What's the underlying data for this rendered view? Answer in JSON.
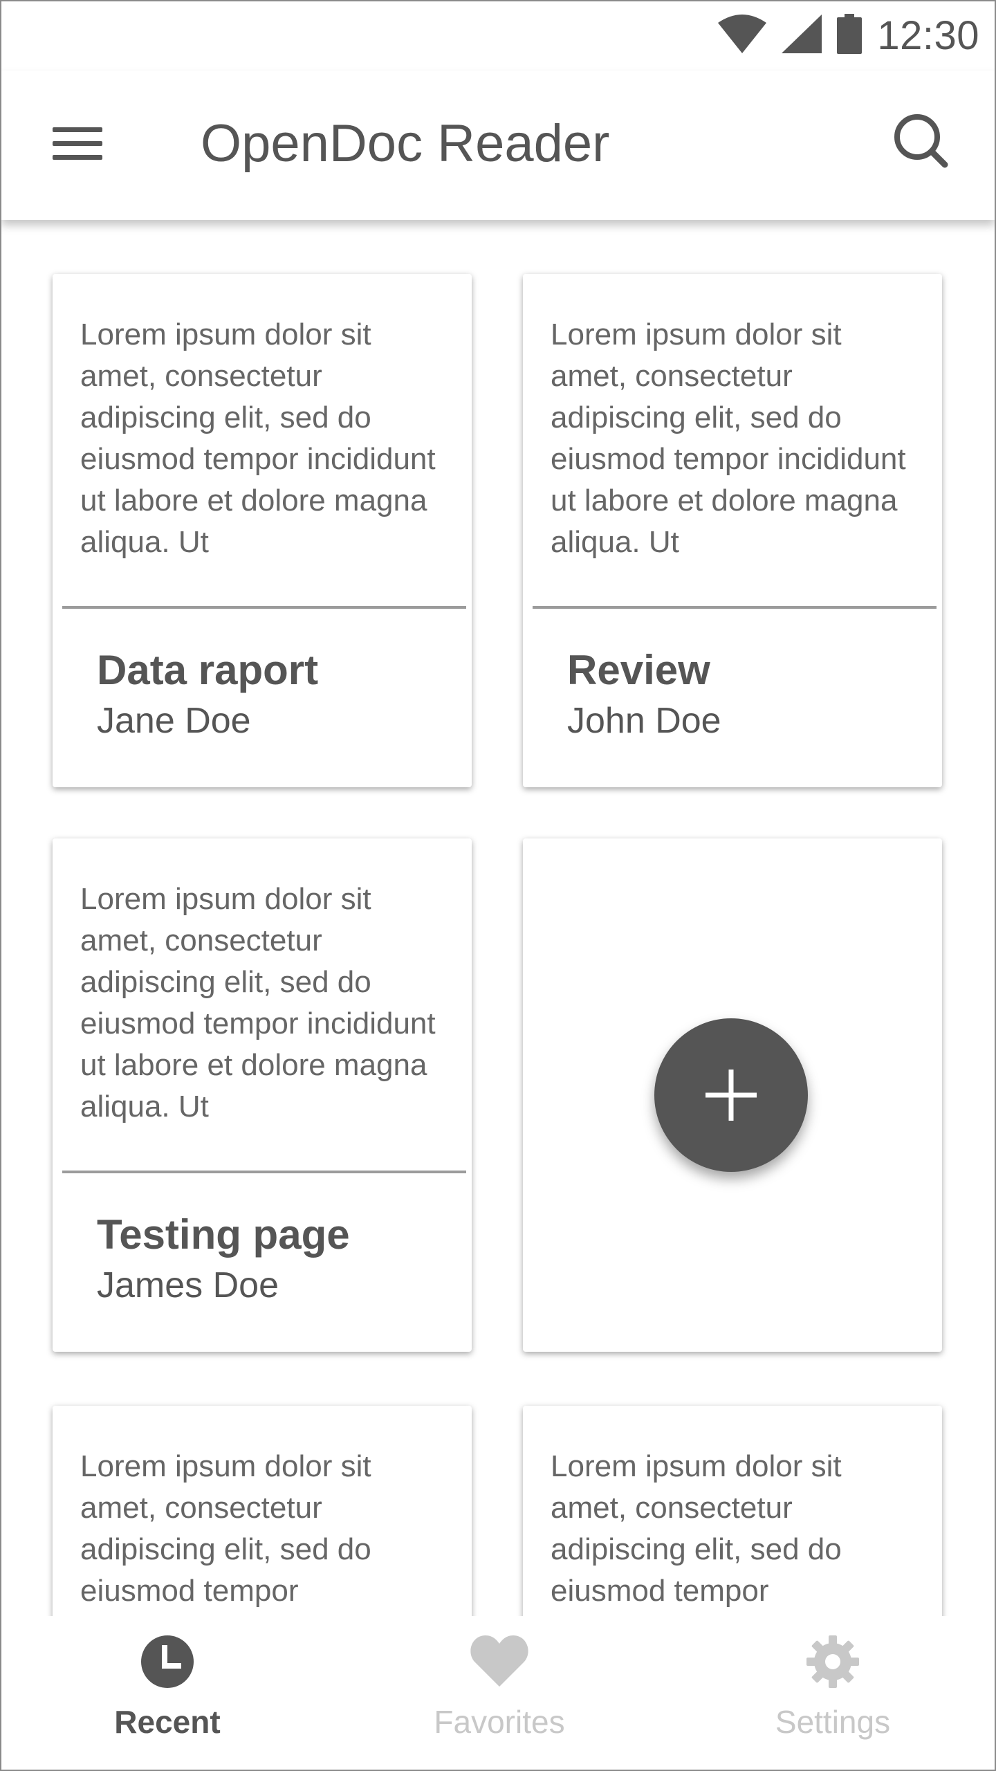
{
  "status_bar": {
    "time": "12:30",
    "icons": [
      "wifi-icon",
      "signal-icon",
      "battery-icon"
    ]
  },
  "app_bar": {
    "menu_icon": "menu-icon",
    "title": "OpenDoc Reader",
    "search_icon": "search-icon"
  },
  "cards": [
    {
      "excerpt": "Lorem ipsum dolor sit amet, consectetur adipiscing elit, sed do eiusmod tempor incididunt ut labore et dolore magna aliqua. Ut",
      "title": "Data raport",
      "author": "Jane Doe"
    },
    {
      "excerpt": "Lorem ipsum dolor sit amet, consectetur adipiscing elit, sed do eiusmod tempor incididunt ut labore et dolore magna aliqua. Ut",
      "title": "Review",
      "author": "John Doe"
    },
    {
      "excerpt": "Lorem ipsum dolor sit amet, consectetur adipiscing elit, sed do eiusmod tempor incididunt ut labore et dolore magna aliqua. Ut",
      "title": "Testing page",
      "author": "James Doe"
    },
    {
      "excerpt": "Lorem ipsum dolor sit amet, consectetur adipiscing elit, sed do eiusmod tempor"
    },
    {
      "excerpt": "Lorem ipsum dolor sit amet, consectetur adipiscing elit, sed do eiusmod tempor"
    }
  ],
  "fab": {
    "icon": "plus-icon"
  },
  "bottom_nav": {
    "items": [
      {
        "label": "Recent",
        "icon": "clock-icon",
        "active": true
      },
      {
        "label": "Favorites",
        "icon": "heart-icon",
        "active": false
      },
      {
        "label": "Settings",
        "icon": "gear-icon",
        "active": false
      }
    ]
  },
  "colors": {
    "primary_gray": "#555555",
    "inactive_gray": "#c8c8c8",
    "divider": "#9b9b9b",
    "background": "#ffffff"
  }
}
